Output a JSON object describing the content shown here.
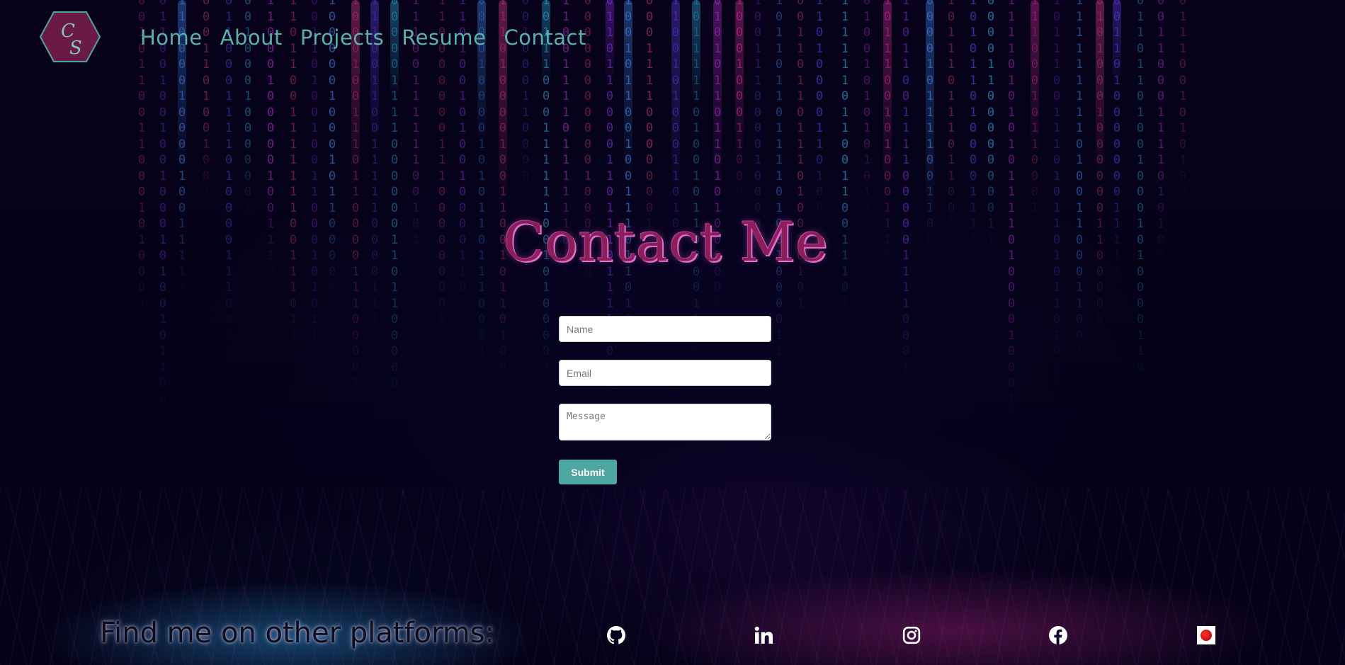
{
  "logo": {
    "letters": [
      "C",
      "S"
    ]
  },
  "nav": {
    "items": [
      {
        "label": "Home"
      },
      {
        "label": "About"
      },
      {
        "label": "Projects"
      },
      {
        "label": "Resume"
      },
      {
        "label": "Contact"
      }
    ]
  },
  "page_title": "Contact Me",
  "form": {
    "name_placeholder": "Name",
    "email_placeholder": "Email",
    "message_placeholder": "Message",
    "submit_label": "Submit"
  },
  "footer": {
    "text": "Find me on other platforms:",
    "socials": [
      {
        "icon": "github-icon"
      },
      {
        "icon": "linkedin-icon"
      },
      {
        "icon": "instagram-icon"
      },
      {
        "icon": "facebook-icon"
      },
      {
        "icon": "badge-image"
      }
    ]
  },
  "colors": {
    "accent_teal": "#4ea6a0",
    "nav_link": "#5ab0aa",
    "logo_fill": "#6b1a45",
    "title_color": "#8a1f5a"
  }
}
